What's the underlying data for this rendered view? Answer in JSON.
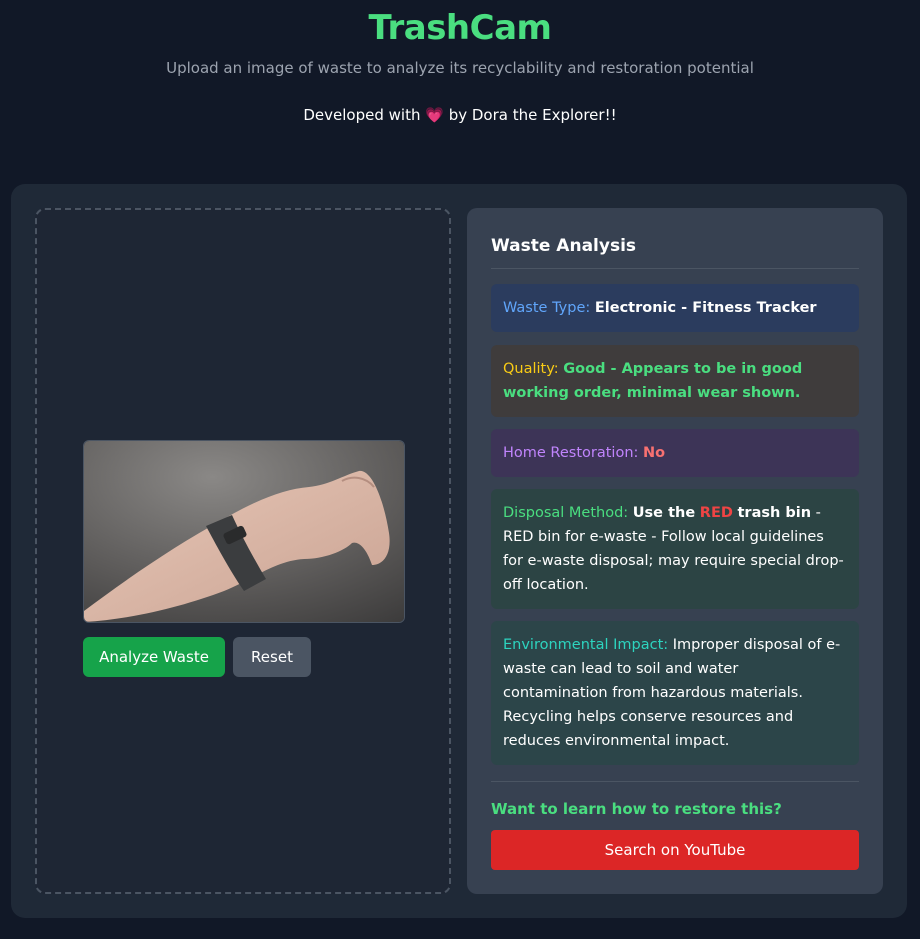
{
  "header": {
    "title": "TrashCam",
    "subtitle": "Upload an image of waste to analyze its recyclability and restoration potential",
    "credit_prefix": "Developed with",
    "credit_suffix": "by Dora the Explorer!!",
    "heart_icon": "heart-icon"
  },
  "upload": {
    "analyze_label": "Analyze Waste",
    "reset_label": "Reset",
    "preview_alt": "wrist with fitness tracker"
  },
  "analysis": {
    "title": "Waste Analysis",
    "waste_type": {
      "label": "Waste Type:",
      "value": "Electronic - Fitness Tracker"
    },
    "quality": {
      "label": "Quality:",
      "value": "Good - Appears to be in good working order, minimal wear shown."
    },
    "home_restoration": {
      "label": "Home Restoration:",
      "value": "No"
    },
    "disposal": {
      "label": "Disposal Method:",
      "value_prefix": "Use the",
      "value_color": "RED",
      "value_suffix": "trash bin",
      "detail": "- RED bin for e-waste - Follow local guidelines for e-waste disposal; may require special drop-off location."
    },
    "environmental": {
      "label": "Environmental Impact:",
      "value": "Improper disposal of e-waste can lead to soil and water contamination from hazardous materials. Recycling helps conserve resources and reduces environmental impact."
    },
    "learn_label": "Want to learn how to restore this?",
    "youtube_label": "Search on YouTube"
  },
  "colors": {
    "accent_green": "#4ade80",
    "label_blue": "#60a5fa",
    "label_yellow": "#facc15",
    "label_purple": "#c084fc",
    "label_teal": "#2dd4bf",
    "label_green": "#4ade80",
    "no_red": "#f87171",
    "youtube_red": "#dc2626"
  }
}
